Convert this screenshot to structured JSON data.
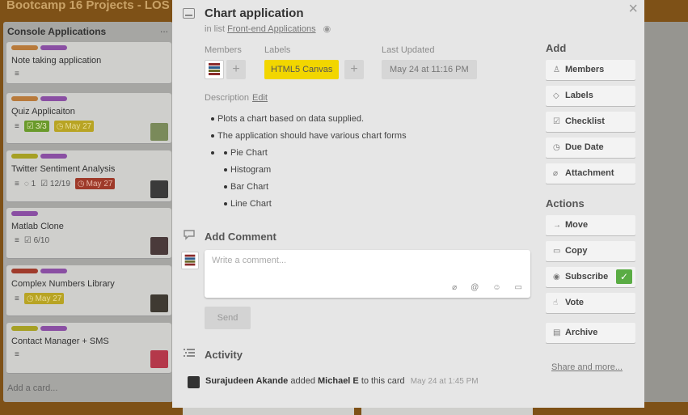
{
  "board": {
    "title": "Bootcamp 16 Projects - LOS",
    "list": {
      "name": "Console Applications",
      "menu": "...",
      "add_card": "Add a card...",
      "cards": [
        {
          "title": "Note taking application",
          "labels": [
            "#b87a3b",
            "#8a4fa3"
          ],
          "badges": []
        },
        {
          "title": "Quiz Applicaiton",
          "labels": [
            "#b87a3b",
            "#8a4fa3"
          ],
          "badges": [
            {
              "type": "checklist",
              "text": "3/3",
              "style": "green"
            },
            {
              "type": "due",
              "text": "May 27",
              "style": "yellow"
            }
          ]
        },
        {
          "title": "Twitter Sentiment Analysis",
          "labels": [
            "#a6a024",
            "#8a4fa3"
          ],
          "badges": [
            {
              "type": "comments",
              "text": "1",
              "style": "plain"
            },
            {
              "type": "checklist",
              "text": "12/19",
              "style": "plain"
            },
            {
              "type": "due",
              "text": "May 27",
              "style": "red"
            }
          ]
        },
        {
          "title": "Matlab Clone",
          "labels": [
            "#8a4fa3"
          ],
          "badges": [
            {
              "type": "checklist",
              "text": "6/10",
              "style": "plain"
            }
          ]
        },
        {
          "title": "Complex Numbers Library",
          "labels": [
            "#a03c2c",
            "#8a4fa3"
          ],
          "badges": [
            {
              "type": "due",
              "text": "May 27",
              "style": "yellow"
            }
          ]
        },
        {
          "title": "Contact Manager + SMS",
          "labels": [
            "#a6a024",
            "#8a4fa3"
          ],
          "badges": []
        }
      ]
    }
  },
  "modal": {
    "title": "Chart application",
    "in_list_prefix": "in list",
    "in_list_name": "Front-end Applications",
    "close": "×",
    "members_label": "Members",
    "labels_label": "Labels",
    "label_chip": "HTML5 Canvas",
    "label_color": "#f2d600",
    "last_updated_label": "Last Updated",
    "last_updated": "May 24 at 11:16 PM",
    "description_label": "Description",
    "edit": "Edit",
    "description": {
      "items": [
        "Plots a chart based on data supplied.",
        "The application should have various chart forms"
      ],
      "sub_items": [
        "Pie Chart",
        "Histogram",
        "Bar Chart",
        "Line Chart"
      ]
    },
    "add_comment_heading": "Add Comment",
    "comment_placeholder": "Write a comment...",
    "send": "Send",
    "activity_heading": "Activity",
    "activity": {
      "actor": "Surajudeen Akande",
      "verb": "added",
      "target": "Michael E",
      "suffix": "to this card",
      "time": "May 24 at 1:45 PM"
    }
  },
  "sidebar": {
    "add_heading": "Add",
    "add_buttons": [
      "Members",
      "Labels",
      "Checklist",
      "Due Date",
      "Attachment"
    ],
    "actions_heading": "Actions",
    "action_buttons": [
      "Move",
      "Copy",
      "Subscribe",
      "Vote",
      "Archive"
    ],
    "subscribe_check": "✓",
    "share": "Share and more..."
  }
}
